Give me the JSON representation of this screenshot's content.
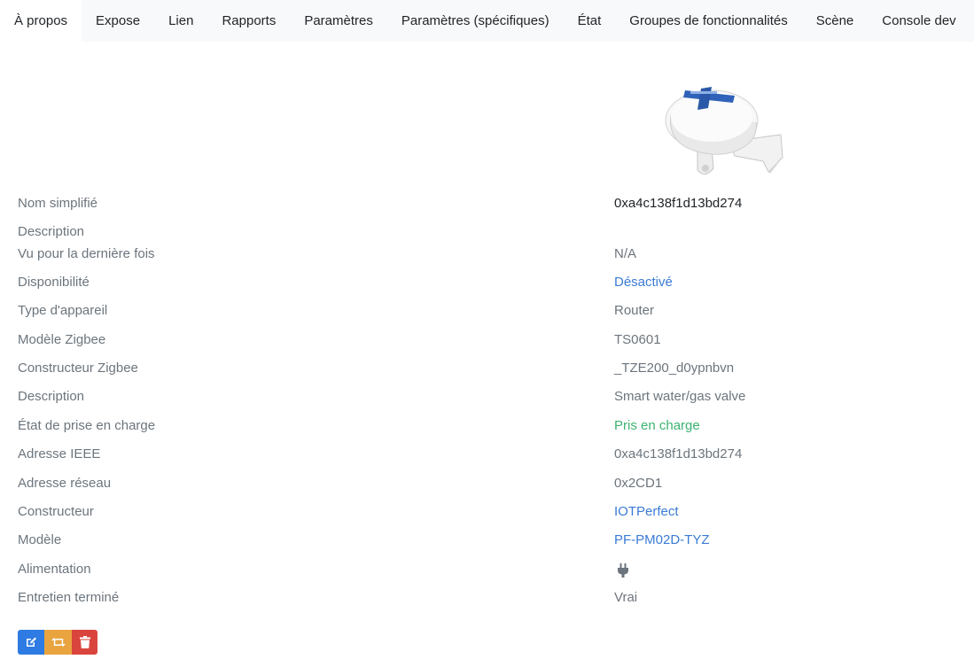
{
  "tabs": [
    {
      "label": "À propos",
      "active": true
    },
    {
      "label": "Expose"
    },
    {
      "label": "Lien"
    },
    {
      "label": "Rapports"
    },
    {
      "label": "Paramètres"
    },
    {
      "label": "Paramètres (spécifiques)"
    },
    {
      "label": "État"
    },
    {
      "label": "Groupes de fonctionnalités"
    },
    {
      "label": "Scène"
    },
    {
      "label": "Console dev"
    }
  ],
  "device": {
    "friendly_name_label": "Nom simplifié",
    "friendly_name": "0xa4c138f1d13bd274",
    "description_label": "Description",
    "last_seen_label": "Vu pour la dernière fois",
    "last_seen": "N/A",
    "availability_label": "Disponibilité",
    "availability": "Désactivé",
    "device_type_label": "Type d'appareil",
    "device_type": "Router",
    "zigbee_model_label": "Modèle Zigbee",
    "zigbee_model": "TS0601",
    "zigbee_manufacturer_label": "Constructeur Zigbee",
    "zigbee_manufacturer": "_TZE200_d0ypnbvn",
    "description2_label": "Description",
    "description2": "Smart water/gas valve",
    "support_status_label": "État de prise en charge",
    "support_status": "Pris en charge",
    "ieee_label": "Adresse IEEE",
    "ieee": "0xa4c138f1d13bd274",
    "network_address_label": "Adresse réseau",
    "network_address": "0x2CD1",
    "manufacturer_label": "Constructeur",
    "manufacturer": "IOTPerfect",
    "model_label": "Modèle",
    "model": "PF-PM02D-TYZ",
    "power_label": "Alimentation",
    "power_icon": "plug-icon",
    "interview_label": "Entretien terminé",
    "interview": "Vrai"
  },
  "actions": {
    "edit_icon": "edit-icon",
    "reconfigure_icon": "retweet-icon",
    "delete_icon": "trash-icon"
  },
  "colors": {
    "link": "#3a7bd5",
    "supported": "#3cb371",
    "edit_button": "#2e7be3",
    "reconfigure_button": "#e9a440",
    "delete_button": "#d9453d"
  }
}
